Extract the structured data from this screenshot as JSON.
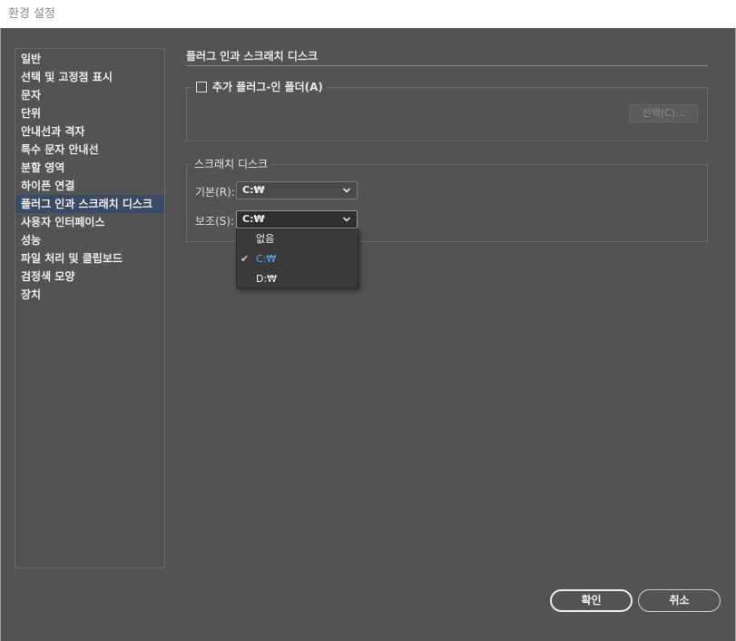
{
  "window": {
    "title": "환경 설정"
  },
  "sidebar": {
    "items": [
      {
        "label": "일반"
      },
      {
        "label": "선택 및 고정점 표시"
      },
      {
        "label": "문자"
      },
      {
        "label": "단위"
      },
      {
        "label": "안내선과 격자"
      },
      {
        "label": "특수 문자 안내선"
      },
      {
        "label": "분할 영역"
      },
      {
        "label": "하이픈 연결"
      },
      {
        "label": "플러그 인과 스크래치 디스크",
        "selected": true
      },
      {
        "label": "사용자 인터페이스"
      },
      {
        "label": "성능"
      },
      {
        "label": "파일 처리 및 클립보드"
      },
      {
        "label": "검정색 모양"
      },
      {
        "label": "장치"
      }
    ]
  },
  "main": {
    "section_title": "플러그 인과 스크래치 디스크",
    "plugins": {
      "checkbox_label": "추가 플러그-인 폴더(A)",
      "checkbox_checked": false,
      "select_button": "선택(C)..."
    },
    "scratch": {
      "legend": "스크래치 디스크",
      "primary_label": "기본(R):",
      "primary_value": "C:₩",
      "secondary_label": "보조(S):",
      "secondary_value": "C:₩",
      "options": [
        {
          "label": "없음",
          "checked": false
        },
        {
          "label": "C:₩",
          "checked": true
        },
        {
          "label": "D:₩",
          "checked": false
        }
      ]
    }
  },
  "footer": {
    "ok_label": "확인",
    "cancel_label": "취소"
  },
  "colors": {
    "background": "#535353",
    "selected_item": "#3b4a63",
    "checked_option": "#58a6ff"
  }
}
